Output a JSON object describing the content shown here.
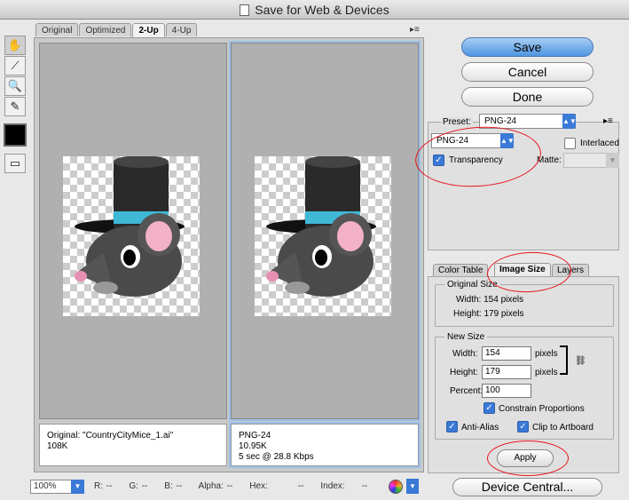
{
  "window": {
    "title": "Save for Web & Devices"
  },
  "tabs": [
    {
      "label": "Original"
    },
    {
      "label": "Optimized"
    },
    {
      "label": "2-Up"
    },
    {
      "label": "4-Up"
    }
  ],
  "tools": [
    "hand-tool",
    "slice-select-tool",
    "zoom-tool",
    "eyedropper-tool"
  ],
  "panes": {
    "left": {
      "line1": "Original: \"CountryCityMice_1.ai\"",
      "line2": "108K"
    },
    "right": {
      "line1": "PNG-24",
      "line2": "10.95K",
      "line3": "5 sec @ 28.8 Kbps"
    }
  },
  "status": {
    "zoom": "100%",
    "r_label": "R:",
    "r_val": "--",
    "g_label": "G:",
    "g_val": "--",
    "b_label": "B:",
    "b_val": "--",
    "alpha_label": "Alpha:",
    "alpha_val": "--",
    "hex_label": "Hex:",
    "hex_val": "--",
    "index_label": "Index:",
    "index_val": "--"
  },
  "buttons": {
    "save": "Save",
    "cancel": "Cancel",
    "done": "Done",
    "apply": "Apply",
    "device_central": "Device Central..."
  },
  "preset": {
    "label": "Preset:",
    "value": "PNG-24",
    "format": "PNG-24",
    "interlaced_label": "Interlaced",
    "interlaced": false,
    "transparency_label": "Transparency",
    "transparency": true,
    "matte_label": "Matte:"
  },
  "bottom_tabs": [
    {
      "label": "Color Table"
    },
    {
      "label": "Image Size"
    },
    {
      "label": "Layers"
    }
  ],
  "image_size": {
    "original_title": "Original Size",
    "orig_width": "Width: 154 pixels",
    "orig_height": "Height: 179 pixels",
    "new_title": "New Size",
    "width_label": "Width:",
    "width_value": "154",
    "height_label": "Height:",
    "height_value": "179",
    "unit": "pixels",
    "percent_label": "Percent:",
    "percent_value": "100",
    "constrain_label": "Constrain Proportions",
    "anti_alias_label": "Anti-Alias",
    "clip_label": "Clip to Artboard"
  },
  "colors": {
    "accent": "#3a79d6",
    "annotation": "#e8131b",
    "canvas": "#b0b0b0"
  }
}
